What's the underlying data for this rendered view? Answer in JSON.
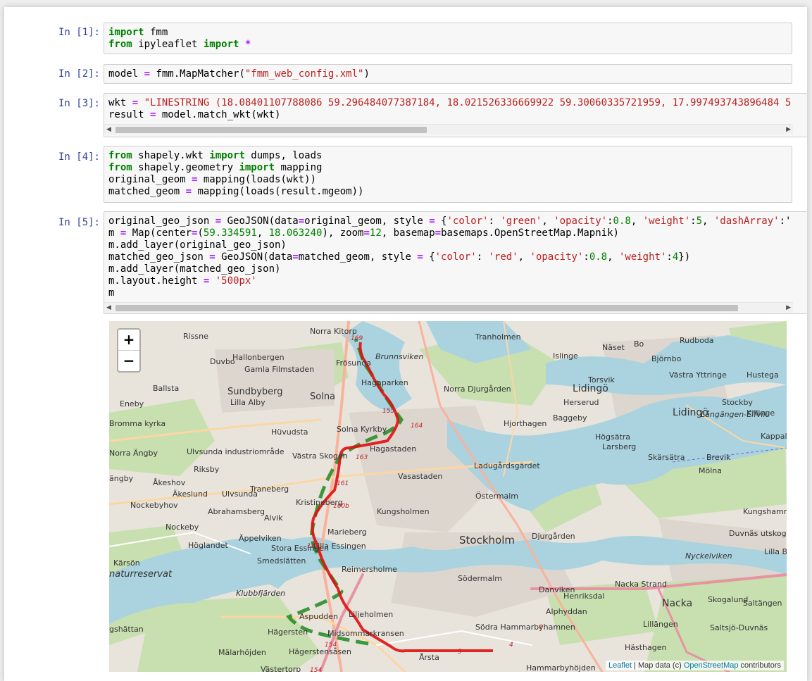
{
  "cells": [
    {
      "prompt": "In [1]:",
      "lines": [
        [
          [
            "kw",
            "import"
          ],
          [
            "t",
            " fmm"
          ]
        ],
        [
          [
            "kw",
            "from"
          ],
          [
            "t",
            " ipyleaflet "
          ],
          [
            "kw",
            "import"
          ],
          [
            "t",
            " "
          ],
          [
            "op",
            "*"
          ]
        ]
      ]
    },
    {
      "prompt": "In [2]:",
      "lines": [
        [
          [
            "t",
            "model "
          ],
          [
            "op",
            "="
          ],
          [
            "t",
            " fmm.MapMatcher("
          ],
          [
            "str",
            "\"fmm_web_config.xml\""
          ],
          [
            "t",
            ")"
          ]
        ]
      ]
    },
    {
      "prompt": "In [3]:",
      "lines": [
        [
          [
            "t",
            "wkt "
          ],
          [
            "op",
            "="
          ],
          [
            "t",
            " "
          ],
          [
            "str",
            "\"LINESTRING (18.08401107788086 59.296484077387184, 18.021526336669922 59.30060335721959, 17.997493743896484 5"
          ]
        ],
        [
          [
            "t",
            "result "
          ],
          [
            "op",
            "="
          ],
          [
            "t",
            " model.match_wkt(wkt)"
          ]
        ]
      ]
    },
    {
      "prompt": "In [4]:",
      "lines": [
        [
          [
            "kw",
            "from"
          ],
          [
            "t",
            " shapely.wkt "
          ],
          [
            "kw",
            "import"
          ],
          [
            "t",
            " dumps, loads"
          ]
        ],
        [
          [
            "kw",
            "from"
          ],
          [
            "t",
            " shapely.geometry "
          ],
          [
            "kw",
            "import"
          ],
          [
            "t",
            " mapping"
          ]
        ],
        [
          [
            "t",
            "original_geom "
          ],
          [
            "op",
            "="
          ],
          [
            "t",
            " mapping(loads(wkt))"
          ]
        ],
        [
          [
            "t",
            "matched_geom "
          ],
          [
            "op",
            "="
          ],
          [
            "t",
            " mapping(loads(result.mgeom))"
          ]
        ]
      ]
    },
    {
      "prompt": "In [5]:",
      "lines": [
        [
          [
            "t",
            "original_geo_json "
          ],
          [
            "op",
            "="
          ],
          [
            "t",
            " GeoJSON(data"
          ],
          [
            "op",
            "="
          ],
          [
            "t",
            "original_geom, style "
          ],
          [
            "op",
            "="
          ],
          [
            "t",
            " {"
          ],
          [
            "str",
            "'color'"
          ],
          [
            "t",
            ": "
          ],
          [
            "str",
            "'green'"
          ],
          [
            "t",
            ", "
          ],
          [
            "str",
            "'opacity'"
          ],
          [
            "t",
            ":"
          ],
          [
            "num",
            "0.8"
          ],
          [
            "t",
            ", "
          ],
          [
            "str",
            "'weight'"
          ],
          [
            "t",
            ":"
          ],
          [
            "num",
            "5"
          ],
          [
            "t",
            ", "
          ],
          [
            "str",
            "'dashArray'"
          ],
          [
            "t",
            ":'"
          ]
        ],
        [
          [
            "t",
            "m "
          ],
          [
            "op",
            "="
          ],
          [
            "t",
            " Map(center"
          ],
          [
            "op",
            "="
          ],
          [
            "t",
            "("
          ],
          [
            "num",
            "59.334591"
          ],
          [
            "t",
            ", "
          ],
          [
            "num",
            "18.063240"
          ],
          [
            "t",
            "), zoom"
          ],
          [
            "op",
            "="
          ],
          [
            "num",
            "12"
          ],
          [
            "t",
            ", basemap"
          ],
          [
            "op",
            "="
          ],
          [
            "t",
            "basemaps.OpenStreetMap.Mapnik)"
          ]
        ],
        [
          [
            "t",
            "m.add_layer(original_geo_json)"
          ]
        ],
        [
          [
            "t",
            "matched_geo_json "
          ],
          [
            "op",
            "="
          ],
          [
            "t",
            " GeoJSON(data"
          ],
          [
            "op",
            "="
          ],
          [
            "t",
            "matched_geom, style "
          ],
          [
            "op",
            "="
          ],
          [
            "t",
            " {"
          ],
          [
            "str",
            "'color'"
          ],
          [
            "t",
            ": "
          ],
          [
            "str",
            "'red'"
          ],
          [
            "t",
            ", "
          ],
          [
            "str",
            "'opacity'"
          ],
          [
            "t",
            ":"
          ],
          [
            "num",
            "0.8"
          ],
          [
            "t",
            ", "
          ],
          [
            "str",
            "'weight'"
          ],
          [
            "t",
            ":"
          ],
          [
            "num",
            "4"
          ],
          [
            "t",
            "})"
          ]
        ],
        [
          [
            "t",
            "m.add_layer(matched_geo_json)"
          ]
        ],
        [
          [
            "t",
            "m.layout.height "
          ],
          [
            "op",
            "="
          ],
          [
            "t",
            " "
          ],
          [
            "str",
            "'500px'"
          ]
        ],
        [
          [
            "t",
            "m"
          ]
        ]
      ]
    }
  ],
  "map": {
    "zoom_in": "+",
    "zoom_out": "−",
    "attribution": {
      "leaflet": "Leaflet",
      "sep": " | Map data (c) ",
      "osm": "OpenStreetMap",
      "tail": " contributors"
    },
    "place_labels": [
      "Norra Kitorp",
      "Rissne",
      "Hallonbergen",
      "Frösunda",
      "Brunnsviken",
      "Tranholmen",
      "Näset",
      "Bo",
      "Rudboda",
      "Islinge",
      "Björnbo",
      "Duvbo",
      "Gamla Filmstaden",
      "Hagaparken",
      "Norra Djurgården",
      "Torsvik",
      "Lidingö",
      "Västra Yttringe",
      "Hustega",
      "Ballsta",
      "Sundbyberg",
      "Solna",
      "Herserud",
      "Stockby",
      "Eneby",
      "Lilla Alby",
      "Baggeby",
      "Lidingö",
      "Långängen-Elfvik",
      "Killinge",
      "Bromma kyrka",
      "Solna Kyrkby",
      "Hjorthagen",
      "Högsätra",
      "Kappala",
      "Hüvudsta",
      "Larsberg",
      "Skärsätra",
      "Brevik",
      "Norra Ängby",
      "Ulvsunda industriområde",
      "Västra Skogen",
      "Hagastaden",
      "Ladugårdsgärdet",
      "Mölna",
      "ängby",
      "Riksby",
      "Vasastaden",
      "Åkeshov",
      "Traneberg",
      "Östermalm",
      "Ulvsunda",
      "Äkeslund",
      "Kristineberg",
      "Kungsholmen",
      "Kungshamn",
      "Nockebyhov",
      "Abrahamsberg",
      "Alvik",
      "Djurgården",
      "Duvnäs utskog",
      "Nockeby",
      "Marieberg",
      "Äppelviken",
      "Lilla Essingen",
      "Stockholm",
      "Nyckelviken",
      "Lilla Bo",
      "Höglandet",
      "Stora Essingen",
      "Kärsön",
      "Södermalm",
      "Nacka Strand",
      "naturreservat",
      "Smedslätten",
      "Reimersholme",
      "Danviken",
      "Henriksdal",
      "Nacka",
      "Skogalund",
      "Klubbfjärden",
      "Alphyddan",
      "Saltängen",
      "Ekr",
      "Aspudden",
      "Liljeholmen",
      "Södra Hammarbyhamnen",
      "Lillängen",
      "Saltsjö-Duvnäs",
      "gshättan",
      "Hägersten",
      "Midsommarkransen",
      "Hästhagen",
      "Mälarhöjden",
      "Hägerstensåsen",
      "Årsta",
      "Hammarbyhöjden",
      "Västertorp"
    ],
    "route_labels": [
      "169",
      "164",
      "163",
      "161",
      "160b",
      "158",
      "154",
      "154",
      "4",
      "5",
      "6",
      "155"
    ],
    "original_line_color": "#1f8a1f",
    "matched_line_color": "#e01010"
  }
}
